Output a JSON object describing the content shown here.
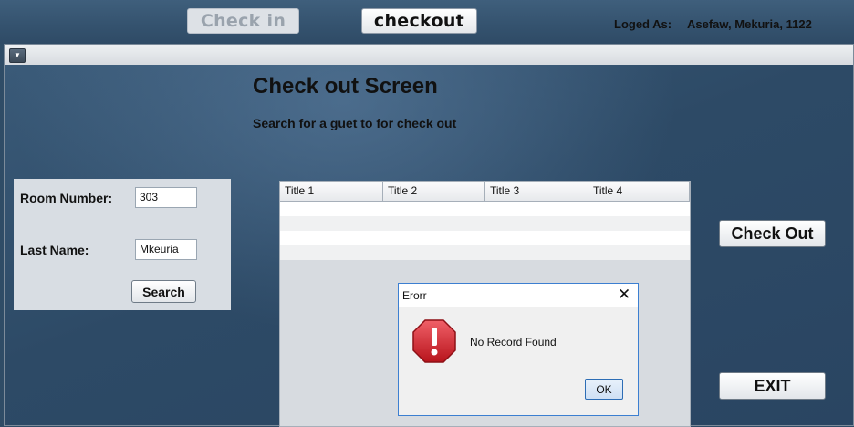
{
  "topbar": {
    "checkin_label": "Check in",
    "checkout_label": "checkout",
    "logged_label": "Loged As:",
    "user": "Asefaw, Mekuria, 1122"
  },
  "window": {
    "menu_icon": "chevron-down-icon"
  },
  "screen": {
    "title": "Check out Screen",
    "subtitle": "Search for a guet to for check out"
  },
  "search_panel": {
    "room_label": "Room Number:",
    "room_value": "303",
    "lastname_label": "Last Name:",
    "lastname_value": "Mkeuria",
    "search_label": "Search"
  },
  "table": {
    "headers": [
      "Title 1",
      "Title 2",
      "Title 3",
      "Title 4"
    ],
    "rows": 4
  },
  "actions": {
    "checkout_label": "Check Out",
    "exit_label": "EXIT"
  },
  "dialog": {
    "title": "Erorr",
    "close_icon": "close-icon",
    "icon": "error-stop-icon",
    "message": "No Record Found",
    "ok_label": "OK"
  },
  "colors": {
    "background": "#2f4c66",
    "panel": "#d8dde3",
    "dialog_border": "#3c7fd1",
    "error_red": "#d7262e"
  }
}
